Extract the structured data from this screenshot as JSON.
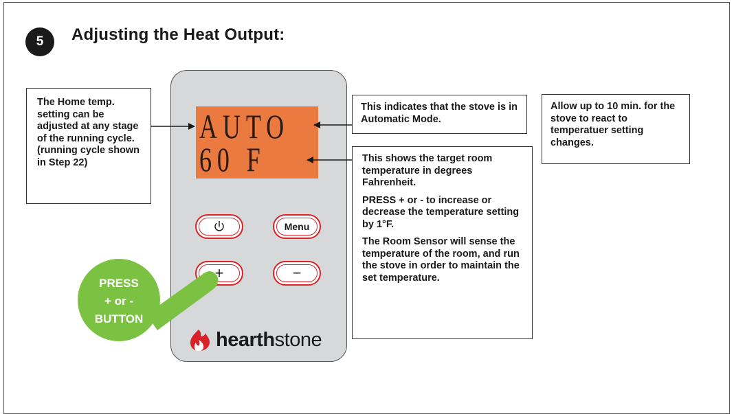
{
  "step": {
    "number": "5",
    "title": "Adjusting the Heat Output:"
  },
  "notes": {
    "home_temp": "The Home temp. setting can be adjusted at any stage of the running cycle. (running cycle shown in Step 22)",
    "auto_mode": "This indicates that the stove is in Automatic Mode.",
    "react_time": "Allow up to 10 min. for the stove to react to temperatuer setting changes.",
    "target_temp": {
      "p1": "This shows the target room temperature in degrees Fahrenheit.",
      "p2": "PRESS + or - to increase or decrease the temperature setting by 1°F.",
      "p3": "The Room Sensor will sense the temperature of the room, and run the stove in order to maintain the set temperature."
    }
  },
  "display": {
    "line1": "AUTO",
    "line2": "60 F"
  },
  "buttons": {
    "power": "power-icon",
    "menu": "Menu",
    "plus": "+",
    "minus": "−"
  },
  "callout": {
    "line1": "PRESS",
    "line2": "+ or -",
    "line3": "BUTTON"
  },
  "brand": {
    "bold": "hearth",
    "regular": "stone"
  },
  "colors": {
    "lcd": "#ea7a3f",
    "accent_red": "#d92128",
    "callout_green": "#7cc242",
    "panel": "#d7d8d9"
  }
}
